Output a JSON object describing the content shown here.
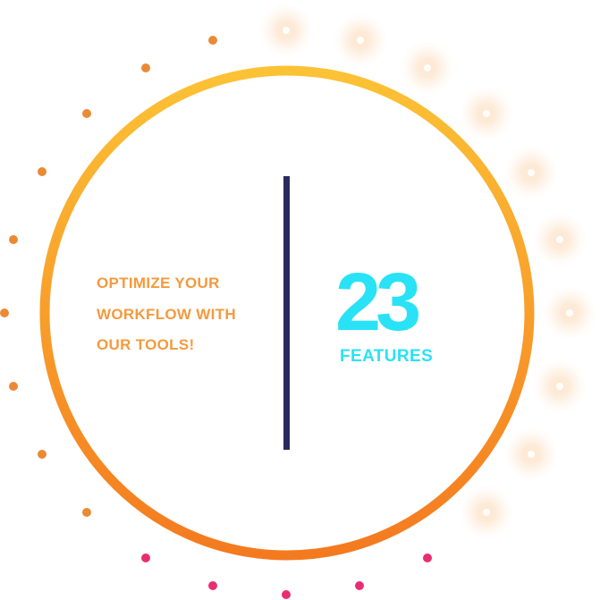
{
  "tagline": {
    "lines": [
      "OPTIMIZE YOUR",
      "WORKFLOW WITH",
      "OUR TOOLS!"
    ]
  },
  "stat": {
    "number": "23",
    "label": "FEATURES"
  },
  "colors": {
    "ring_top": "#fcc235",
    "ring_bottom": "#f47a20",
    "tagline": "#f49a3e",
    "divider": "#2b2a5e",
    "stat": "#29e2f5",
    "dot_orange": "#ea8a34",
    "dot_pink": "#ea2d72",
    "glow": "#fbd3aa"
  }
}
